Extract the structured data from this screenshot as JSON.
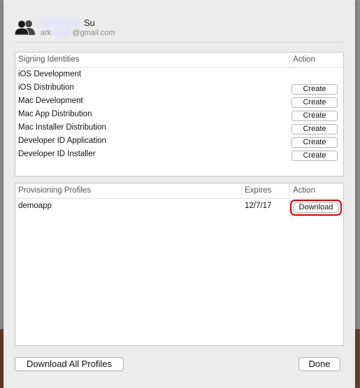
{
  "account": {
    "name_suffix": "Su",
    "email_prefix": "ark",
    "email_domain": "@gmail.com",
    "avatar_icon": "people-icon"
  },
  "signing": {
    "headers": {
      "identities": "Signing Identities",
      "action": "Action"
    },
    "rows": [
      {
        "label": "iOS Development",
        "action": ""
      },
      {
        "label": "iOS Distribution",
        "action": "Create"
      },
      {
        "label": "Mac Development",
        "action": "Create"
      },
      {
        "label": "Mac App Distribution",
        "action": "Create"
      },
      {
        "label": "Mac Installer Distribution",
        "action": "Create"
      },
      {
        "label": "Developer ID Application",
        "action": "Create"
      },
      {
        "label": "Developer ID Installer",
        "action": "Create"
      }
    ]
  },
  "profiles": {
    "headers": {
      "profiles": "Provisioning Profiles",
      "expires": "Expires",
      "action": "Action"
    },
    "rows": [
      {
        "name": "demoapp",
        "expires": "12/7/17",
        "action": "Download",
        "highlight_color": "#d20000"
      }
    ]
  },
  "footer": {
    "download_all": "Download All Profiles",
    "done": "Done"
  }
}
